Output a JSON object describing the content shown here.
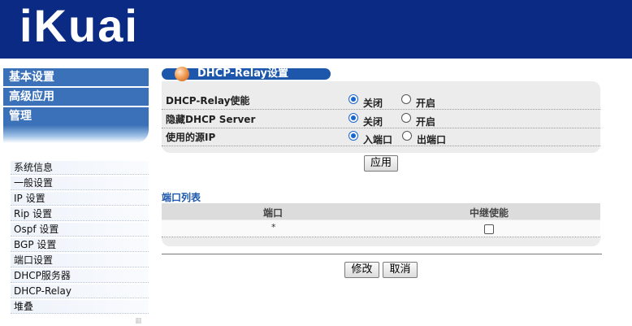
{
  "header": {
    "logo_text": "iKuai"
  },
  "sidebar": {
    "top_nav": [
      "基本设置",
      "高级应用",
      "管理"
    ],
    "items": [
      "系统信息",
      "一般设置",
      "IP 设置",
      "Rip 设置",
      "Ospf 设置",
      "BGP 设置",
      "端口设置",
      "DHCP服务器",
      "DHCP-Relay",
      "堆叠"
    ]
  },
  "main": {
    "section_title": "DHCP-Relay设置",
    "settings": [
      {
        "label": "DHCP-Relay使能",
        "options": [
          "关闭",
          "开启"
        ],
        "selected": 0
      },
      {
        "label": "隐藏DHCP Server",
        "options": [
          "关闭",
          "开启"
        ],
        "selected": 0
      },
      {
        "label": "使用的源IP",
        "options": [
          "入端口",
          "出端口"
        ],
        "selected": 0
      }
    ],
    "apply_label": "应用",
    "ports": {
      "title": "端口列表",
      "columns": [
        "端口",
        "中继使能"
      ],
      "rows": [
        {
          "port": "*",
          "relay_enabled": false
        }
      ]
    },
    "modify_label": "修改",
    "cancel_label": "取消"
  },
  "colors": {
    "header_bg": "#0a2a84",
    "nav_bg": "#3b71b8",
    "accent": "#1c57ac",
    "panel_bg": "#ececec"
  }
}
